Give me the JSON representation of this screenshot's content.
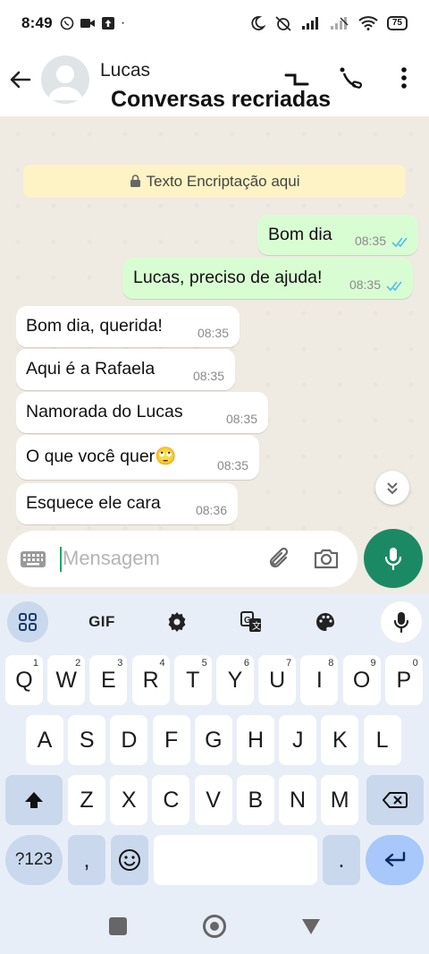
{
  "status_bar": {
    "time": "8:49",
    "battery": "75"
  },
  "header": {
    "contact_name": "Lucas",
    "overlay_title": "Conversas recriadas"
  },
  "chat": {
    "encryption_banner": "Texto Encriptação aqui",
    "messages": [
      {
        "direction": "out",
        "text": "Bom dia",
        "time": "08:35",
        "status": "read"
      },
      {
        "direction": "out",
        "text": "Lucas, preciso de ajuda!",
        "time": "08:35",
        "status": "read"
      },
      {
        "direction": "in",
        "text": "Bom dia, querida!",
        "time": "08:35"
      },
      {
        "direction": "in",
        "text": "Aqui é a Rafaela",
        "time": "08:35"
      },
      {
        "direction": "in",
        "text": "Namorada do Lucas",
        "time": "08:35"
      },
      {
        "direction": "in",
        "text": "O que você quer🙄",
        "time": "08:35"
      },
      {
        "direction": "in",
        "text": "Esquece ele cara",
        "time": "08:36"
      }
    ]
  },
  "composer": {
    "placeholder": "Mensagem"
  },
  "keyboard": {
    "toolbar": {
      "gif_label": "GIF"
    },
    "row1": [
      {
        "key": "Q",
        "hint": "1"
      },
      {
        "key": "W",
        "hint": "2"
      },
      {
        "key": "E",
        "hint": "3"
      },
      {
        "key": "R",
        "hint": "4"
      },
      {
        "key": "T",
        "hint": "5"
      },
      {
        "key": "Y",
        "hint": "6"
      },
      {
        "key": "U",
        "hint": "7"
      },
      {
        "key": "I",
        "hint": "8"
      },
      {
        "key": "O",
        "hint": "9"
      },
      {
        "key": "P",
        "hint": "0"
      }
    ],
    "row2": [
      "A",
      "S",
      "D",
      "F",
      "G",
      "H",
      "J",
      "K",
      "L"
    ],
    "row3": [
      "Z",
      "X",
      "C",
      "V",
      "B",
      "N",
      "M"
    ],
    "symbols_label": "?123",
    "comma": ",",
    "period": "."
  },
  "colors": {
    "chat_background": "#efeae2",
    "outgoing_bubble": "#d9fdd3",
    "incoming_bubble": "#ffffff",
    "accent": "#1b8a64",
    "read_ticks": "#53bdeb",
    "encryption_banner": "#fdf3c5"
  }
}
